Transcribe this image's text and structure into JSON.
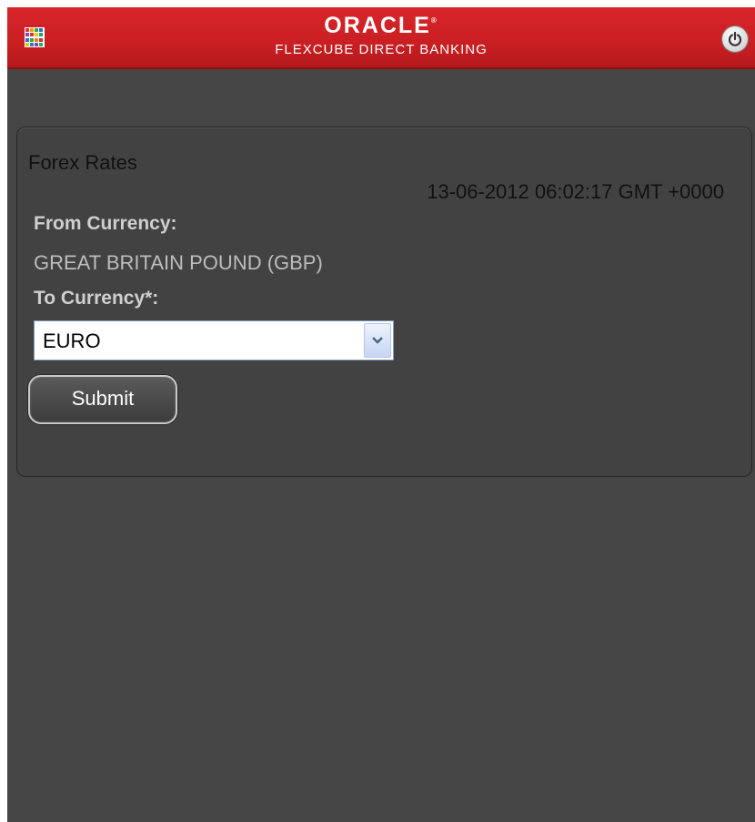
{
  "header": {
    "logo_text": "ORACLE",
    "logo_mark": "®",
    "product_name": "FLEXCUBE DIRECT BANKING",
    "accent_color": "#c91f23",
    "menu_icon": "app-grid-icon",
    "power_icon": "power-icon"
  },
  "form": {
    "title": "Forex Rates",
    "timestamp": "13-06-2012 06:02:17 GMT +0000",
    "from_currency_label": "From Currency:",
    "from_currency_value": "GREAT BRITAIN POUND (GBP)",
    "to_currency_label": "To Currency*:",
    "to_currency_selected": "EURO",
    "submit_label": "Submit"
  }
}
